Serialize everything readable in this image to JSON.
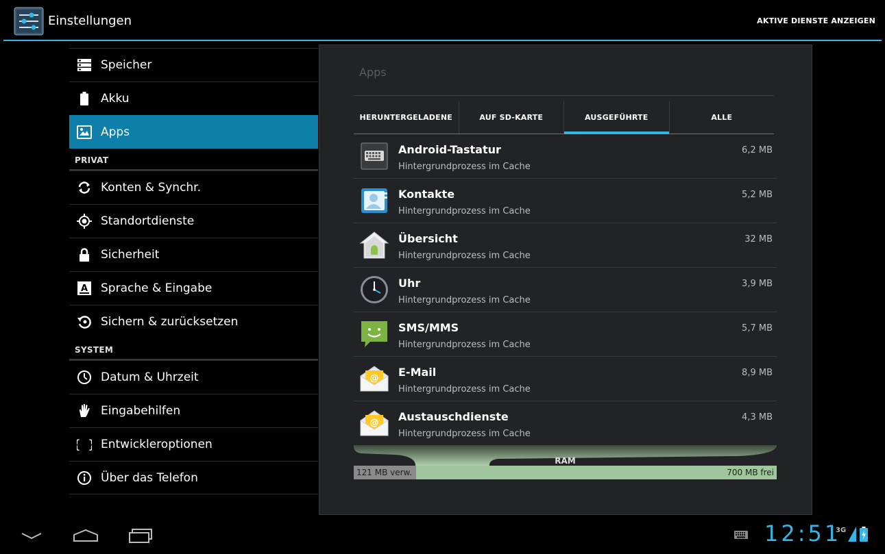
{
  "actionbar": {
    "title": "Einstellungen",
    "action_label": "AKTIVE DIENSTE ANZEIGEN",
    "accent": "#33b5e5"
  },
  "sidebar": {
    "top_items": [
      {
        "label": "Speicher",
        "icon": "storage-icon"
      },
      {
        "label": "Akku",
        "icon": "battery-icon"
      },
      {
        "label": "Apps",
        "icon": "apps-icon",
        "active": true
      }
    ],
    "privat_header": "PRIVAT",
    "privat_items": [
      {
        "label": "Konten & Synchr.",
        "icon": "sync-icon"
      },
      {
        "label": "Standortdienste",
        "icon": "location-icon"
      },
      {
        "label": "Sicherheit",
        "icon": "lock-icon"
      },
      {
        "label": "Sprache & Eingabe",
        "icon": "language-icon"
      },
      {
        "label": "Sichern & zurücksetzen",
        "icon": "backup-icon"
      }
    ],
    "system_header": "SYSTEM",
    "system_items": [
      {
        "label": "Datum & Uhrzeit",
        "icon": "clock-icon"
      },
      {
        "label": "Eingabehilfen",
        "icon": "hand-icon"
      },
      {
        "label": "Entwickleroptionen",
        "icon": "braces-icon"
      },
      {
        "label": "Über das Telefon",
        "icon": "info-icon"
      }
    ],
    "active_color": "#0d7fa8"
  },
  "panel": {
    "title": "Apps",
    "tabs": [
      {
        "label": "HERUNTERGELADENE"
      },
      {
        "label": "AUF SD-KARTE"
      },
      {
        "label": "AUSGEFÜHRTE",
        "selected": true
      },
      {
        "label": "ALLE"
      }
    ],
    "apps": [
      {
        "name": "Android-Tastatur",
        "sub": "Hintergrundprozess im Cache",
        "size": "6,2 MB",
        "icon": "keyboard-icon"
      },
      {
        "name": "Kontakte",
        "sub": "Hintergrundprozess im Cache",
        "size": "5,2 MB",
        "icon": "contacts-icon"
      },
      {
        "name": "Übersicht",
        "sub": "Hintergrundprozess im Cache",
        "size": "32 MB",
        "icon": "home-android-icon"
      },
      {
        "name": "Uhr",
        "sub": "Hintergrundprozess im Cache",
        "size": "3,9 MB",
        "icon": "clock-app-icon"
      },
      {
        "name": "SMS/MMS",
        "sub": "Hintergrundprozess im Cache",
        "size": "5,7 MB",
        "icon": "sms-icon"
      },
      {
        "name": "E-Mail",
        "sub": "Hintergrundprozess im Cache",
        "size": "8,9 MB",
        "icon": "email-icon"
      },
      {
        "name": "Austauschdienste",
        "sub": "Hintergrundprozess im Cache",
        "size": "4,3 MB",
        "icon": "exchange-icon"
      }
    ],
    "ram": {
      "label": "RAM",
      "used_label": "121 MB verw.",
      "free_label": "700 MB frei",
      "used_fraction": 0.147
    }
  },
  "statusbar": {
    "clock": "12:51",
    "network": "3G"
  }
}
